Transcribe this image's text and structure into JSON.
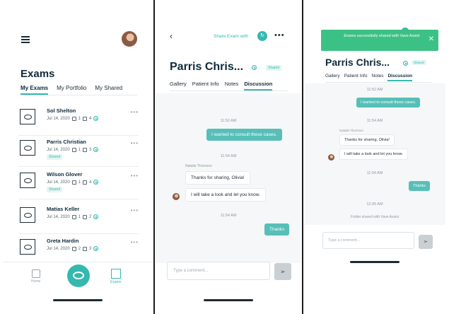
{
  "screen1": {
    "title": "Exams",
    "tabs": [
      {
        "label": "My Exams",
        "active": true
      },
      {
        "label": "My Portfolio",
        "active": false
      },
      {
        "label": "My Shared",
        "active": false
      }
    ],
    "exams": [
      {
        "name": "Sol Shelton",
        "date": "Jul 14, 2020",
        "notes": "1",
        "images": "4",
        "shared": false
      },
      {
        "name": "Parris Christian",
        "date": "Jul 14, 2020",
        "notes": "1",
        "images": "3",
        "shared": true
      },
      {
        "name": "Wilson Glover",
        "date": "Jul 14, 2020",
        "notes": "1",
        "images": "4",
        "shared": true
      },
      {
        "name": "Matias Keller",
        "date": "Jul 14, 2020",
        "notes": "1",
        "images": "2",
        "shared": false
      },
      {
        "name": "Greta Hardin",
        "date": "Jul 14, 2020",
        "notes": "2",
        "images": "3",
        "shared": false
      }
    ],
    "shared_label": "Shared",
    "more": "•••",
    "nav": {
      "home": "Home",
      "exams": "Exams"
    }
  },
  "screen2": {
    "back": "‹",
    "share_label": "Share Exam with",
    "share_icon": "↻",
    "more": "•••",
    "patient_name": "Parris Chris...",
    "shared_tag": "Shared",
    "tabs": [
      {
        "label": "Gallery",
        "active": false
      },
      {
        "label": "Patient Info",
        "active": false
      },
      {
        "label": "Notes",
        "active": false
      },
      {
        "label": "Discussion",
        "active": true
      }
    ],
    "messages": {
      "ts1": "11:52 AM",
      "out1": "I wanted to consult these cases.",
      "ts2": "11:54 AM",
      "sender": "Natalie Thomson",
      "in1": "Thanks for sharing, Olivia!",
      "in2": "I will take a look and let you know.",
      "ts3": "11:54 AM",
      "out2": "Thanks"
    },
    "composer_placeholder": "Type a comment...",
    "send_icon": "➢"
  },
  "screen3": {
    "toast": "Exams successfully shared with Vave Assist",
    "toast_close": "✕",
    "patient_name": "Parris Chris...",
    "shared_tag": "Shared",
    "tabs": [
      {
        "label": "Gallery",
        "active": false
      },
      {
        "label": "Patient Info",
        "active": false
      },
      {
        "label": "Notes",
        "active": false
      },
      {
        "label": "Discussion",
        "active": true
      }
    ],
    "messages": {
      "ts1": "11:52 AM",
      "out1": "I wanted to consult these cases.",
      "ts2": "11:54 AM",
      "sender": "Natalie Thomson",
      "in1": "Thanks for sharing, Olivia!",
      "in2": "I will take a look and let you know.",
      "ts3": "11:54 AM",
      "out2": "Thanks",
      "ts4": "12:05 AM",
      "folder_note": "Folder shared with Vave Assist"
    },
    "composer_placeholder": "Type a comment...",
    "send_icon": "➢"
  },
  "colors": {
    "accent": "#35b8b0",
    "toast": "#3cc184",
    "text": "#0f2a3a"
  }
}
